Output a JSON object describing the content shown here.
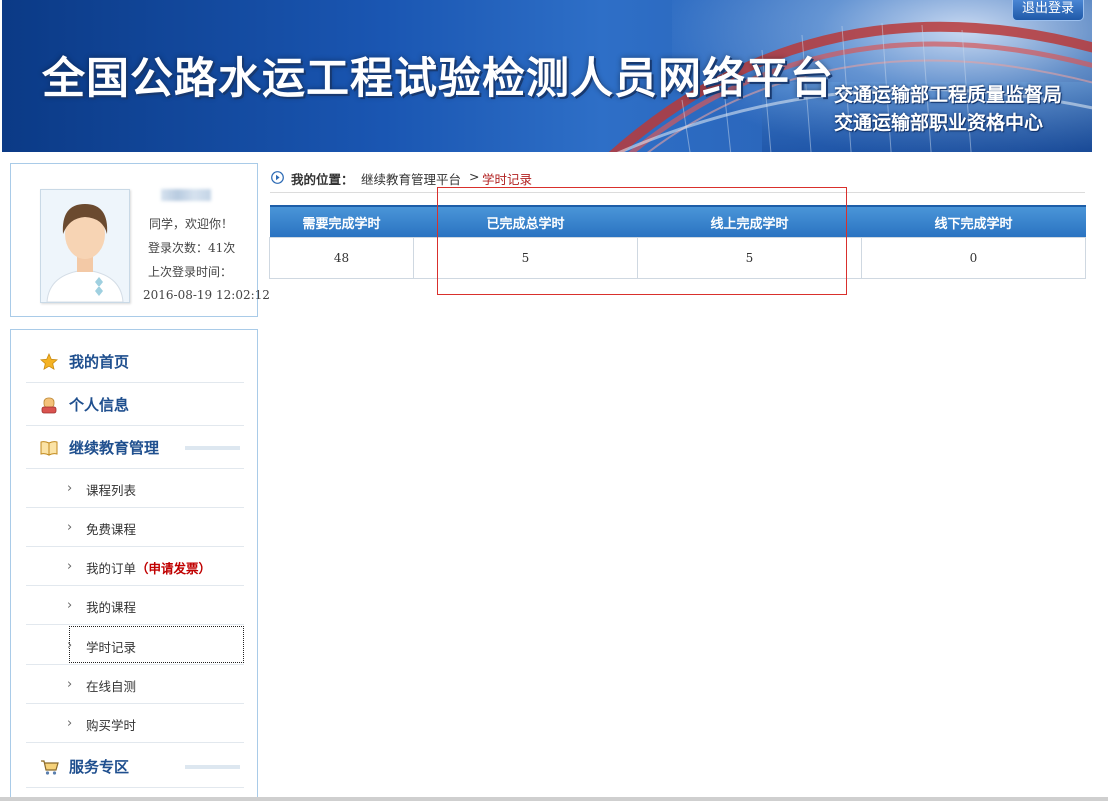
{
  "header": {
    "site_title": "全国公路水运工程试验检测人员网络平台",
    "org_line1": "交通运输部工程质量监督局",
    "org_line2": "交通运输部职业资格中心",
    "logout_label": "退出登录",
    "brand_color": "#1a56b2"
  },
  "profile": {
    "greeting": "同学，欢迎你！",
    "login_count": "登录次数：41次",
    "last_login_label": "上次登录时间：",
    "last_login_time": "2016-08-19 12:02:12"
  },
  "nav": {
    "home": {
      "label": "我的首页",
      "icon": "star-icon"
    },
    "personal_info": {
      "label": "个人信息",
      "icon": "user-icon"
    },
    "continuing_edu": {
      "label": "继续教育管理",
      "icon": "book-icon"
    },
    "sub_items": [
      {
        "label": "课程列表"
      },
      {
        "label": "免费课程"
      },
      {
        "label": "我的订单",
        "extra_open": "（",
        "extra": "申请发票",
        "extra_close": "）"
      },
      {
        "label": "我的课程"
      },
      {
        "label": "学时记录",
        "active": true
      },
      {
        "label": "在线自测"
      },
      {
        "label": "购买学时"
      }
    ],
    "services": {
      "label": "服务专区",
      "icon": "cart-icon"
    }
  },
  "breadcrumb": {
    "label": "我的位置：",
    "path1": "继续教育管理平台",
    "separator": ">",
    "current": "学时记录"
  },
  "hours_table": {
    "columns": [
      "需要完成学时",
      "已完成总学时",
      "线上完成学时",
      "线下完成学时"
    ],
    "row": [
      "48",
      "5",
      "5",
      "0"
    ],
    "header_color": "#3585cf"
  },
  "highlight_color": "#d9302c"
}
